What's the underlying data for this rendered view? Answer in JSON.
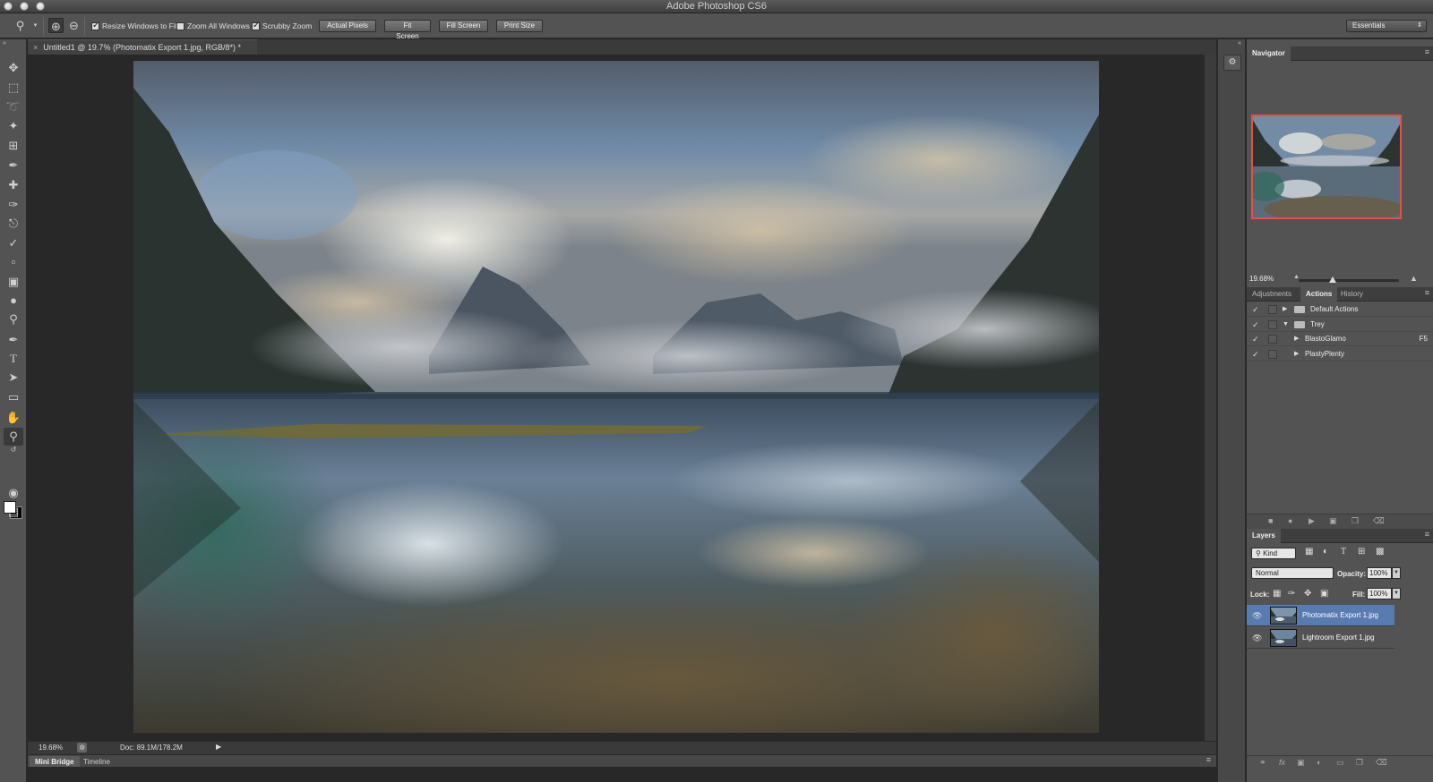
{
  "app": {
    "title": "Adobe Photoshop CS6"
  },
  "options": {
    "resize_windows": {
      "label": "Resize Windows to Fit",
      "checked": true
    },
    "zoom_all": {
      "label": "Zoom All Windows",
      "checked": false
    },
    "scrubby_zoom": {
      "label": "Scrubby Zoom",
      "checked": true
    },
    "buttons": [
      "Actual Pixels",
      "Fit Screen",
      "Fill Screen",
      "Print Size"
    ],
    "workspace": "Essentials"
  },
  "document": {
    "tab_title": "Untitled1 @ 19.7% (Photomatix Export 1.jpg, RGB/8*) *",
    "zoom": "19.68%",
    "doc_size": "Doc: 89.1M/178.2M"
  },
  "bottom_tabs": [
    "Mini Bridge",
    "Timeline"
  ],
  "navigator": {
    "tab": "Navigator",
    "zoom": "19.68%"
  },
  "actions_panel": {
    "tabs": [
      "Adjustments",
      "Actions",
      "History"
    ],
    "active_tab": "Actions",
    "items": [
      {
        "label": "Default Actions",
        "type": "set",
        "expanded": false
      },
      {
        "label": "Trey",
        "type": "set",
        "expanded": true
      },
      {
        "label": "BlastoGlamo",
        "type": "action",
        "shortcut": "F5"
      },
      {
        "label": "PlastyPlenty",
        "type": "action",
        "shortcut": ""
      }
    ]
  },
  "layers_panel": {
    "tab": "Layers",
    "filter_kind": "Kind",
    "blend_mode": "Normal",
    "opacity_label": "Opacity:",
    "opacity": "100%",
    "lock_label": "Lock:",
    "fill_label": "Fill:",
    "fill": "100%",
    "layers": [
      {
        "name": "Photomatix Export 1.jpg",
        "selected": true
      },
      {
        "name": "Lightroom Export 1.jpg",
        "selected": false
      }
    ]
  },
  "colors": {
    "selection": "#587bb0",
    "navigator_frame": "#e0524a"
  }
}
